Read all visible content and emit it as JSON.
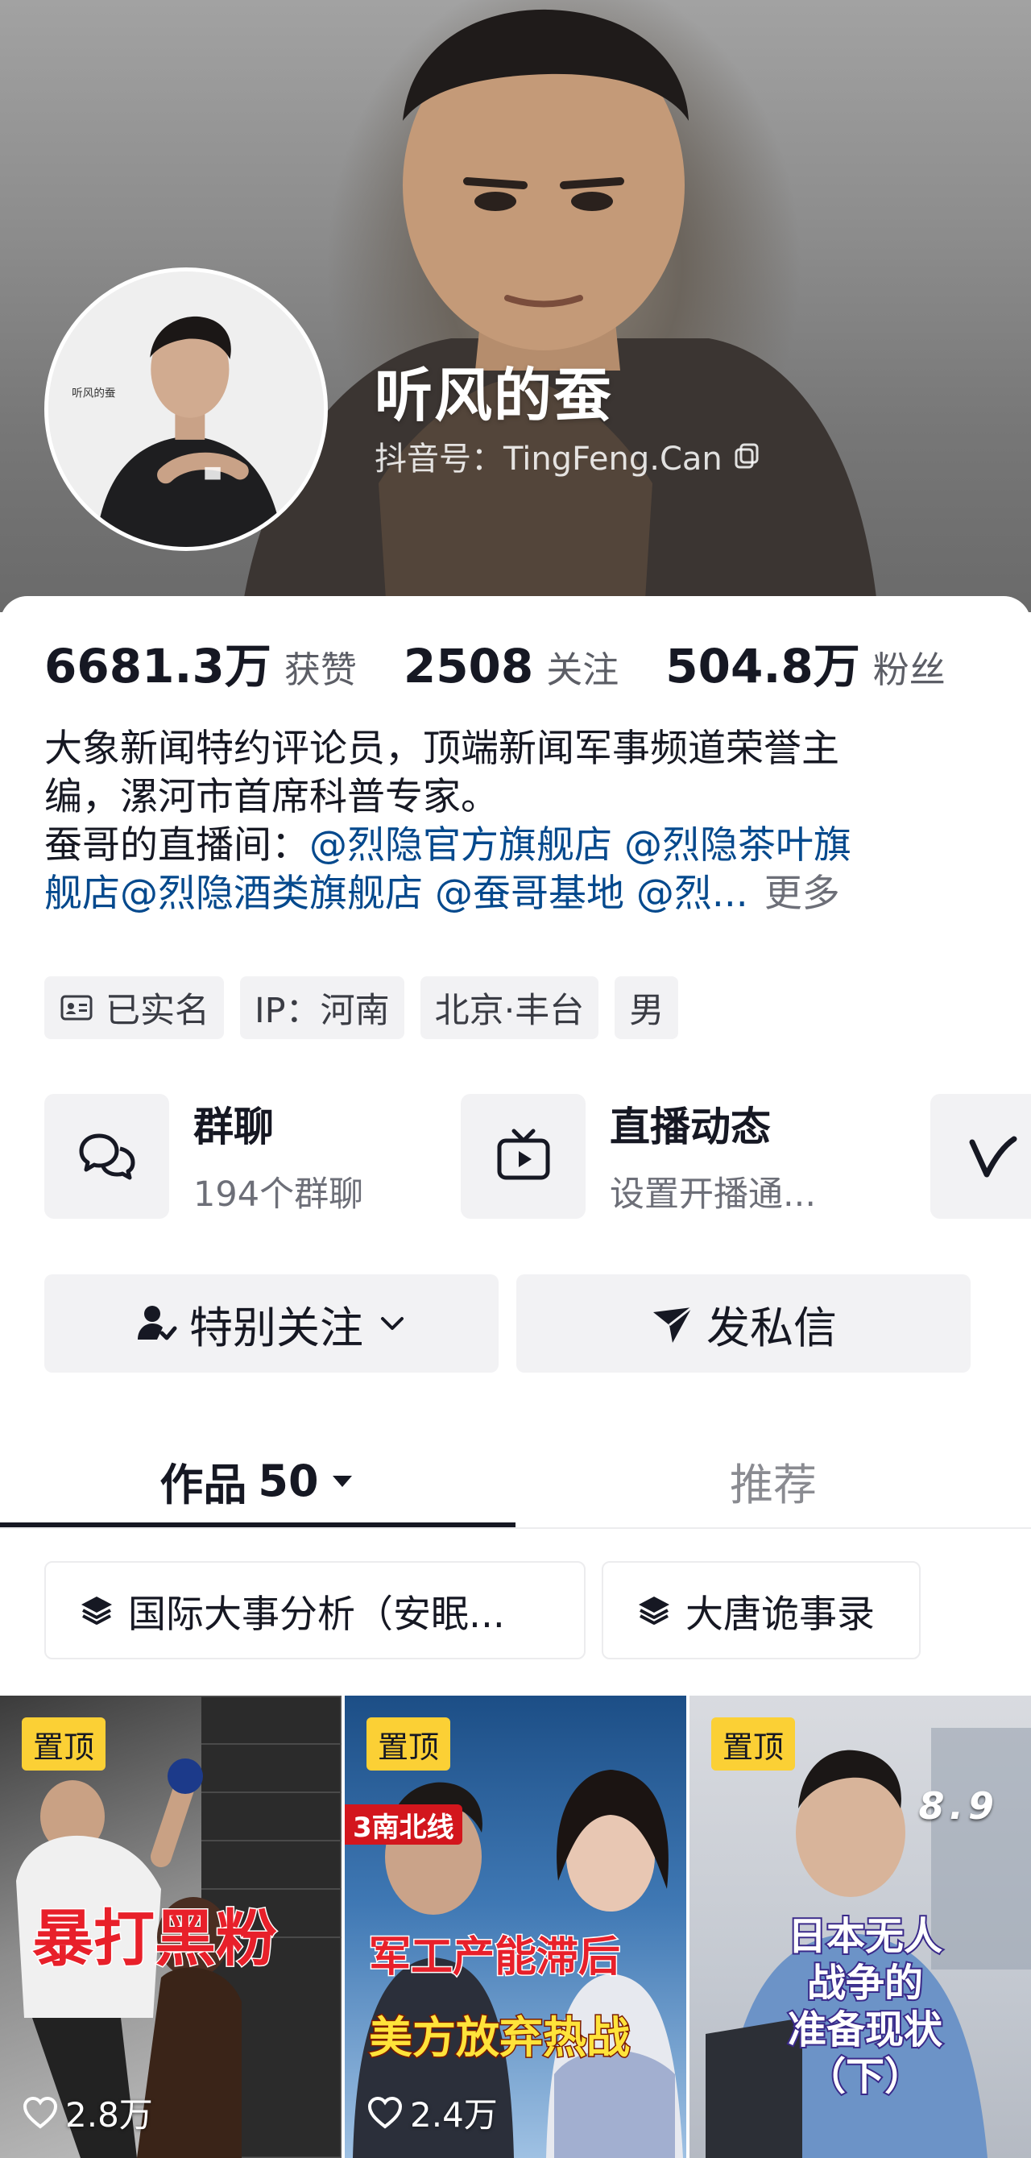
{
  "profile": {
    "nickname": "听风的蚕",
    "douyin_id": "抖音号：TingFeng.Can"
  },
  "stats": [
    {
      "value": "6681.3万",
      "label": "获赞"
    },
    {
      "value": "2508",
      "label": "关注"
    },
    {
      "value": "504.8万",
      "label": "粉丝"
    }
  ],
  "bio": {
    "line1": "大象新闻特约评论员，顶端新闻军事频道荣誉主",
    "line2": "编，漯河市首席科普专家。",
    "line3_prefix": "蚕哥的直播间：",
    "line3_links": "@烈隐官方旗舰店 @烈隐茶叶旗",
    "line4_links": "舰店@烈隐酒类旗舰店 @蚕哥基地 @烈...",
    "more": "更多"
  },
  "tags": [
    {
      "label": "已实名",
      "icon": "id-card-icon"
    },
    {
      "label": "IP：河南"
    },
    {
      "label": "北京·丰台"
    },
    {
      "label": "男"
    }
  ],
  "features": [
    {
      "title": "群聊",
      "subtitle": "194个群聊",
      "icon": "chat-bubbles-icon"
    },
    {
      "title": "直播动态",
      "subtitle": "设置开播通...",
      "icon": "tv-play-icon"
    },
    {
      "icon": "v-logo-icon"
    }
  ],
  "actions": {
    "follow": "特别关注",
    "message": "发私信"
  },
  "tabs": {
    "works_label": "作品",
    "works_count": "50",
    "recommend": "推荐"
  },
  "collections": [
    {
      "label": "国际大事分析（安眠...",
      "icon": "layers-icon"
    },
    {
      "label": "大唐诡事录",
      "icon": "layers-icon"
    }
  ],
  "videos": [
    {
      "pin": "置顶",
      "overlay": "暴打黑粉",
      "likes": "2.8万"
    },
    {
      "pin": "置顶",
      "show_logo": "3南北线",
      "overlay_top": "军工产能滞后",
      "overlay_bottom": "美方放弃热战",
      "likes": "2.4万"
    },
    {
      "pin": "置顶",
      "score": "8.9",
      "overlay_lines": [
        "日本无人",
        "战争的",
        "准备现状",
        "（下）"
      ]
    }
  ],
  "colors": {
    "link": "#04498d",
    "pin_badge": "#fbd035",
    "overlay_red": "#e8202a",
    "overlay_yellow": "#ffe33a"
  }
}
